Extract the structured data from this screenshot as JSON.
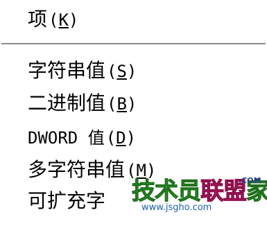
{
  "menu": {
    "items": [
      {
        "label": "项",
        "accel_open": "(",
        "accel_key": "K",
        "accel_close": ")"
      },
      {
        "label": "字符串值",
        "accel_open": "(",
        "accel_key": "S",
        "accel_close": ")"
      },
      {
        "label": "二进制值",
        "accel_open": "(",
        "accel_key": "B",
        "accel_close": ")"
      },
      {
        "label": "DWORD 值",
        "accel_open": "(",
        "accel_key": "D",
        "accel_close": ")"
      },
      {
        "label": "多字符串值",
        "accel_open": "(",
        "accel_key": "M",
        "accel_close": ")"
      },
      {
        "label": "可扩充字",
        "accel_open": "",
        "accel_key": "",
        "accel_close": ""
      }
    ]
  },
  "watermark": {
    "logo_text_a": "技术员",
    "logo_text_b": "联盟",
    "logo_suffix": "家",
    "com_text": ".COM",
    "url": "www.jsgho.com"
  },
  "colors": {
    "background": "#ffffff",
    "text": "#000000",
    "separator": "#8a8a8a",
    "watermark_green": "#3aa635",
    "watermark_pink": "#d9247c",
    "watermark_blue": "#1d5fa8"
  }
}
